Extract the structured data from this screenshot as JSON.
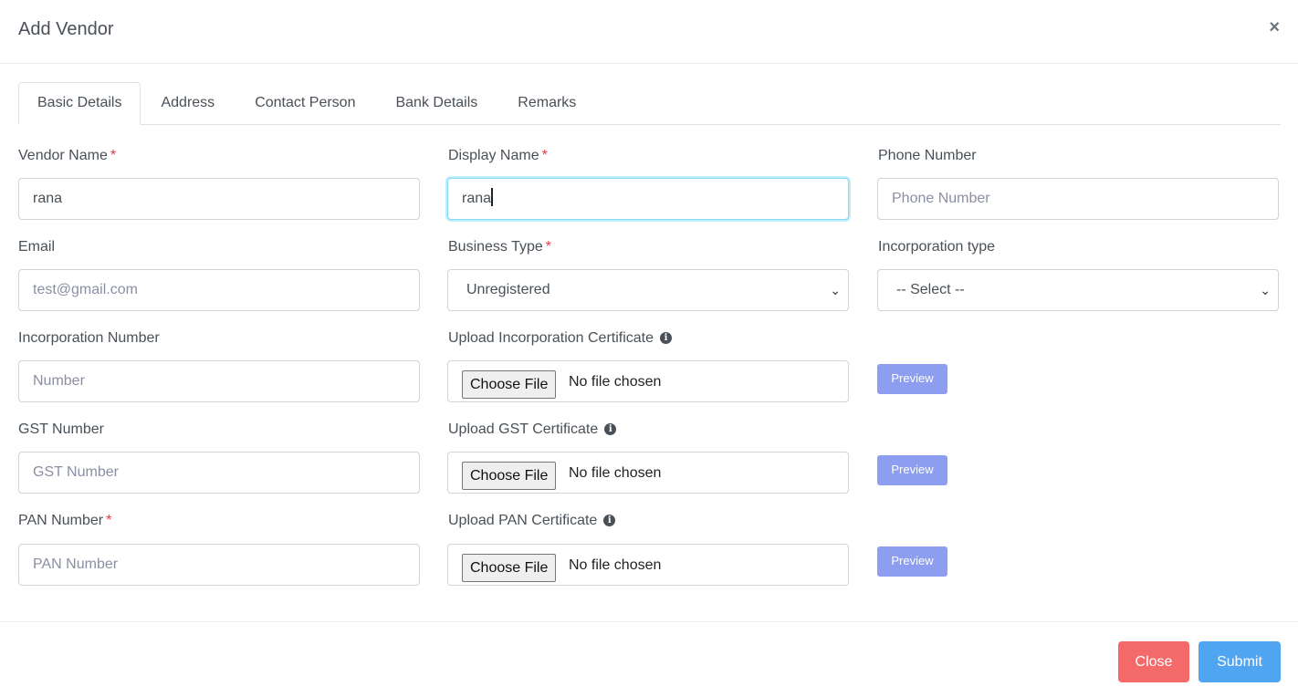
{
  "modal": {
    "title": "Add Vendor",
    "close_icon": "×"
  },
  "tabs": [
    {
      "label": "Basic Details",
      "active": true
    },
    {
      "label": "Address",
      "active": false
    },
    {
      "label": "Contact Person",
      "active": false
    },
    {
      "label": "Bank Details",
      "active": false
    },
    {
      "label": "Remarks",
      "active": false
    }
  ],
  "form": {
    "vendor_name": {
      "label": "Vendor Name",
      "required": "*",
      "value": "rana"
    },
    "display_name": {
      "label": "Display Name",
      "required": "*",
      "value": "rana"
    },
    "phone_number": {
      "label": "Phone Number",
      "placeholder": "Phone Number"
    },
    "email": {
      "label": "Email",
      "placeholder": "test@gmail.com"
    },
    "business_type": {
      "label": "Business Type",
      "required": "*",
      "selected": "Unregistered"
    },
    "incorporation_type": {
      "label": "Incorporation type",
      "selected": "-- Select --"
    },
    "incorporation_number": {
      "label": "Incorporation Number",
      "placeholder": "Number"
    },
    "upload_incorporation": {
      "label": "Upload Incorporation Certificate",
      "info_icon": "i",
      "choose_label": "Choose File",
      "status": "No file chosen",
      "preview_label": "Preview"
    },
    "gst_number": {
      "label": "GST Number",
      "placeholder": "GST Number"
    },
    "upload_gst": {
      "label": "Upload GST Certificate",
      "info_icon": "i",
      "choose_label": "Choose File",
      "status": "No file chosen",
      "preview_label": "Preview"
    },
    "pan_number": {
      "label": "PAN Number",
      "required": "*",
      "placeholder": "PAN Number"
    },
    "upload_pan": {
      "label": "Upload PAN Certificate",
      "info_icon": "i",
      "choose_label": "Choose File",
      "status": "No file chosen",
      "preview_label": "Preview"
    },
    "chevron_icon": "⌄"
  },
  "footer": {
    "close_label": "Close",
    "submit_label": "Submit"
  },
  "colors": {
    "close_button": "#f46a6a",
    "submit_button": "#50a5f1",
    "preview_button": "#8d9ef0",
    "required_star": "#f1343b",
    "focus_border": "#80d8f7"
  }
}
